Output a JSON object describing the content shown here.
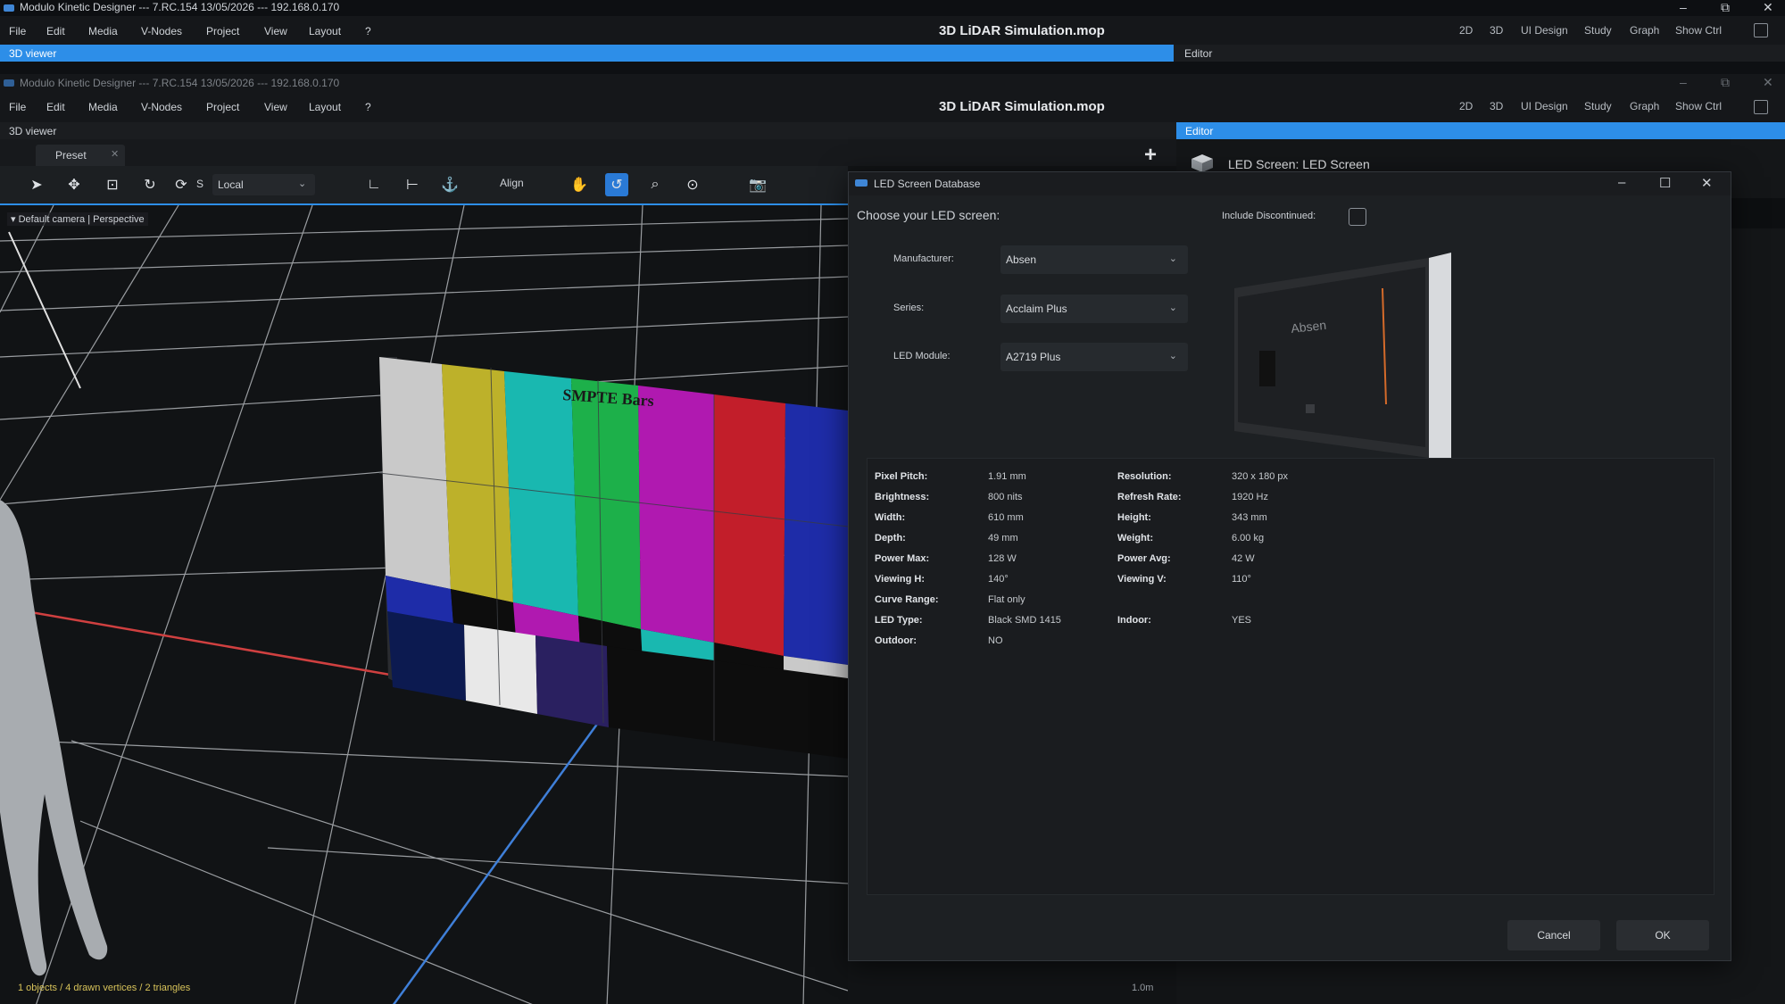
{
  "back_window": {
    "title": "Modulo Kinetic Designer --- 7.RC.154 13/05/2026 --- 192.168.0.170",
    "menu": [
      "File",
      "Edit",
      "Media",
      "V-Nodes",
      "Project",
      "View",
      "Layout",
      "?"
    ],
    "document": "3D LiDAR Simulation.mop",
    "modes": [
      "2D",
      "3D",
      "UI Design",
      "Study",
      "Graph",
      "Show Ctrl"
    ],
    "viewer_tab": "3D viewer",
    "editor_tab": "Editor"
  },
  "front_window": {
    "title": "Modulo Kinetic Designer --- 7.RC.154 13/05/2026 --- 192.168.0.170",
    "menu": [
      "File",
      "Edit",
      "Media",
      "V-Nodes",
      "Project",
      "View",
      "Layout",
      "?"
    ],
    "document": "3D LiDAR Simulation.mop",
    "modes": [
      "2D",
      "3D",
      "UI Design",
      "Study",
      "Graph",
      "Show Ctrl"
    ],
    "viewer_tab": "3D viewer",
    "editor_tab": "Editor",
    "preset_tab": "Preset",
    "toolbar": {
      "scale_letter": "S",
      "space_select": "Local",
      "align_label": "Align"
    },
    "viewport": {
      "camera_label": "Default camera",
      "projection_label": "Perspective",
      "wall_label": "SMPTE Bars",
      "status": "1 objects / 4 drawn vertices / 2 triangles",
      "scale": "1.0m"
    },
    "editor_header": "LED Screen: LED Screen"
  },
  "dialog": {
    "title": "LED Screen Database",
    "prompt": "Choose your LED screen:",
    "include_discontinued_label": "Include Discontinued:",
    "include_discontinued": false,
    "manufacturer_label": "Manufacturer:",
    "manufacturer": "Absen",
    "series_label": "Series:",
    "series": "Acclaim Plus",
    "module_label": "LED Module:",
    "module": "A2719 Plus",
    "preview_brand": "Absen",
    "specs": [
      {
        "key": "Pixel Pitch:",
        "value": "1.91 mm"
      },
      {
        "key": "Resolution:",
        "value": "320 x 180 px"
      },
      {
        "key": "Brightness:",
        "value": "800 nits"
      },
      {
        "key": "Refresh Rate:",
        "value": "1920 Hz"
      },
      {
        "key": "Width:",
        "value": "610 mm"
      },
      {
        "key": "Height:",
        "value": "343 mm"
      },
      {
        "key": "Depth:",
        "value": "49 mm"
      },
      {
        "key": "Weight:",
        "value": "6.00 kg"
      },
      {
        "key": "Power Max:",
        "value": "128 W"
      },
      {
        "key": "Power Avg:",
        "value": "42 W"
      },
      {
        "key": "Viewing H:",
        "value": "140°"
      },
      {
        "key": "Viewing V:",
        "value": "110°"
      },
      {
        "key": "Curve Range:",
        "value": "Flat only"
      },
      {
        "key": "LED Type:",
        "value": "Black SMD 1415"
      },
      {
        "key": "Indoor:",
        "value": "YES"
      },
      {
        "key": "Outdoor:",
        "value": "NO"
      }
    ],
    "cancel_label": "Cancel",
    "ok_label": "OK"
  },
  "colors": {
    "accent": "#2d8ee8",
    "bg": "#121416",
    "dialog_bg": "#1d2023"
  }
}
